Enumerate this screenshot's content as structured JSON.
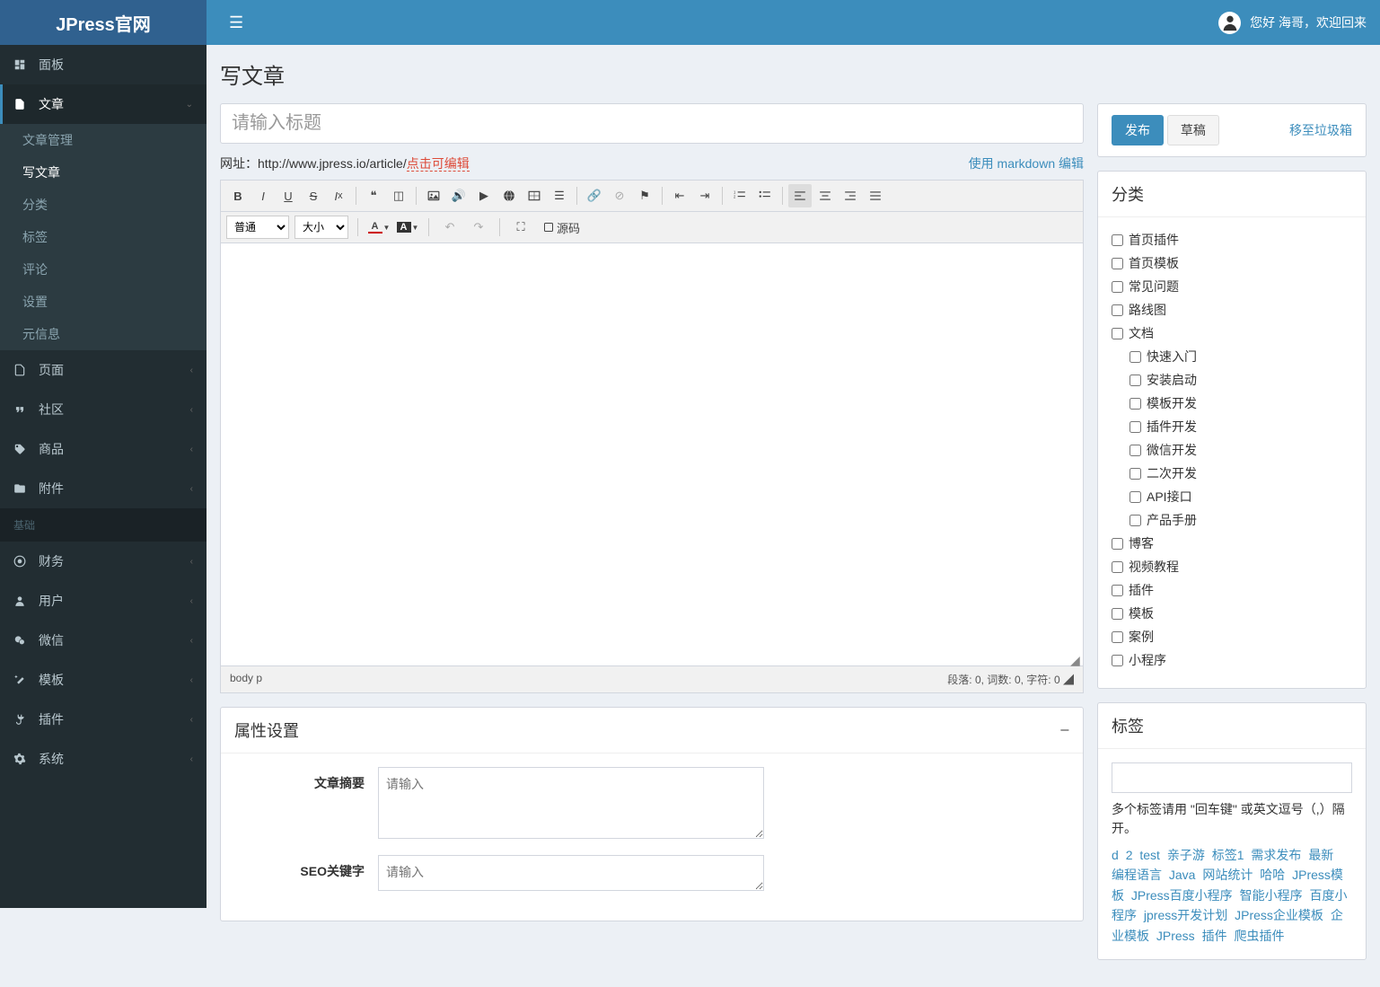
{
  "header": {
    "logo": "JPress官网",
    "welcome": "您好 海哥，欢迎回来"
  },
  "sidebar": {
    "items": [
      {
        "label": "面板",
        "icon": "dashboard"
      },
      {
        "label": "文章",
        "icon": "file",
        "active": true,
        "open": true,
        "children": [
          {
            "label": "文章管理"
          },
          {
            "label": "写文章",
            "active": true
          },
          {
            "label": "分类"
          },
          {
            "label": "标签"
          },
          {
            "label": "评论"
          },
          {
            "label": "设置"
          },
          {
            "label": "元信息"
          }
        ]
      },
      {
        "label": "页面",
        "icon": "file-o"
      },
      {
        "label": "社区",
        "icon": "quote"
      },
      {
        "label": "商品",
        "icon": "tag"
      },
      {
        "label": "附件",
        "icon": "folder"
      }
    ],
    "section_label": "基础",
    "items2": [
      {
        "label": "财务",
        "icon": "cc"
      },
      {
        "label": "用户",
        "icon": "user"
      },
      {
        "label": "微信",
        "icon": "wechat"
      },
      {
        "label": "模板",
        "icon": "magic"
      },
      {
        "label": "插件",
        "icon": "plug"
      },
      {
        "label": "系统",
        "icon": "gear"
      }
    ]
  },
  "page": {
    "title": "写文章",
    "title_placeholder": "请输入标题",
    "url_label": "网址：",
    "url_base": "http://www.jpress.io/article/",
    "url_slug": "点击可编辑",
    "markdown_link": "使用 markdown 编辑"
  },
  "editor": {
    "format_select": "普通",
    "size_select": "大小",
    "source_label": "源码",
    "path": "body   p",
    "stats": "段落: 0, 词数: 0, 字符: 0"
  },
  "properties": {
    "header": "属性设置",
    "summary_label": "文章摘要",
    "summary_placeholder": "请输入",
    "seo_label": "SEO关键字",
    "seo_placeholder": "请输入"
  },
  "actions": {
    "publish": "发布",
    "draft": "草稿",
    "trash": "移至垃圾箱"
  },
  "categories": {
    "header": "分类",
    "items": [
      {
        "label": "首页插件"
      },
      {
        "label": "首页模板"
      },
      {
        "label": "常见问题"
      },
      {
        "label": "路线图"
      },
      {
        "label": "文档",
        "children": [
          {
            "label": "快速入门"
          },
          {
            "label": "安装启动"
          },
          {
            "label": "模板开发"
          },
          {
            "label": "插件开发"
          },
          {
            "label": "微信开发"
          },
          {
            "label": "二次开发"
          },
          {
            "label": "API接口"
          },
          {
            "label": "产品手册"
          }
        ]
      },
      {
        "label": "博客"
      },
      {
        "label": "视频教程"
      },
      {
        "label": "插件"
      },
      {
        "label": "模板"
      },
      {
        "label": "案例"
      },
      {
        "label": "小程序"
      }
    ]
  },
  "tags": {
    "header": "标签",
    "hint": "多个标签请用 \"回车键\" 或英文逗号（,）隔开。",
    "cloud": [
      "d",
      "2",
      "test",
      "亲子游",
      "标签1",
      "需求发布",
      "最新",
      "编程语言",
      "Java",
      "网站统计",
      "哈哈",
      "JPress模板",
      "JPress百度小程序",
      "智能小程序",
      "百度小程序",
      "jpress开发计划",
      "JPress企业模板",
      "企业模板",
      "JPress",
      "插件",
      "爬虫插件"
    ]
  }
}
